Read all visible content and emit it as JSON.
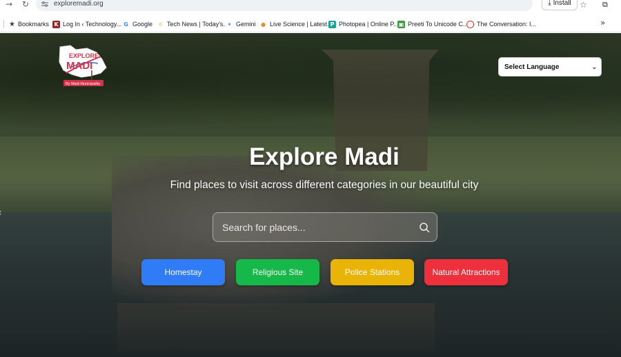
{
  "browser": {
    "url": "exploremadi.org",
    "install_label": "Install",
    "bookmarks": [
      {
        "label": "Bookmarks",
        "icon": "star-icon"
      },
      {
        "label": "Log In ‹ Technology...",
        "icon": "wordpress-icon",
        "color": "#8b2a2a"
      },
      {
        "label": "Google",
        "icon": "google-icon",
        "color": "#4285f4"
      },
      {
        "label": "Tech News | Today's...",
        "icon": "sun-icon",
        "color": "#f4a11b"
      },
      {
        "label": "Gemini",
        "icon": "gemini-icon",
        "color": "#5b8def"
      },
      {
        "label": "Live Science | Latest...",
        "icon": "livescience-icon",
        "color": "#f08a24"
      },
      {
        "label": "Photopea | Online P...",
        "icon": "photopea-icon",
        "color": "#18a497"
      },
      {
        "label": "Preeti To Unicode C...",
        "icon": "image-icon",
        "color": "#3c9a3c"
      },
      {
        "label": "The Conversation: I...",
        "icon": "conversation-icon",
        "color": "#d93025"
      }
    ]
  },
  "page": {
    "logo_text": "EXPLORE MADI",
    "logo_tagline": "By Madi Municipality",
    "language_select": "Select Language",
    "title": "Explore Madi",
    "subtitle": "Find places to visit across different categories in our beautiful city",
    "search_placeholder": "Search for places...",
    "categories": [
      {
        "label": "Homestay",
        "color": "#2f7cf6"
      },
      {
        "label": "Religious Site",
        "color": "#17b84a"
      },
      {
        "label": "Police Stations",
        "color": "#eab308"
      },
      {
        "label": "Natural Attractions",
        "color": "#ee2f3c"
      }
    ]
  }
}
